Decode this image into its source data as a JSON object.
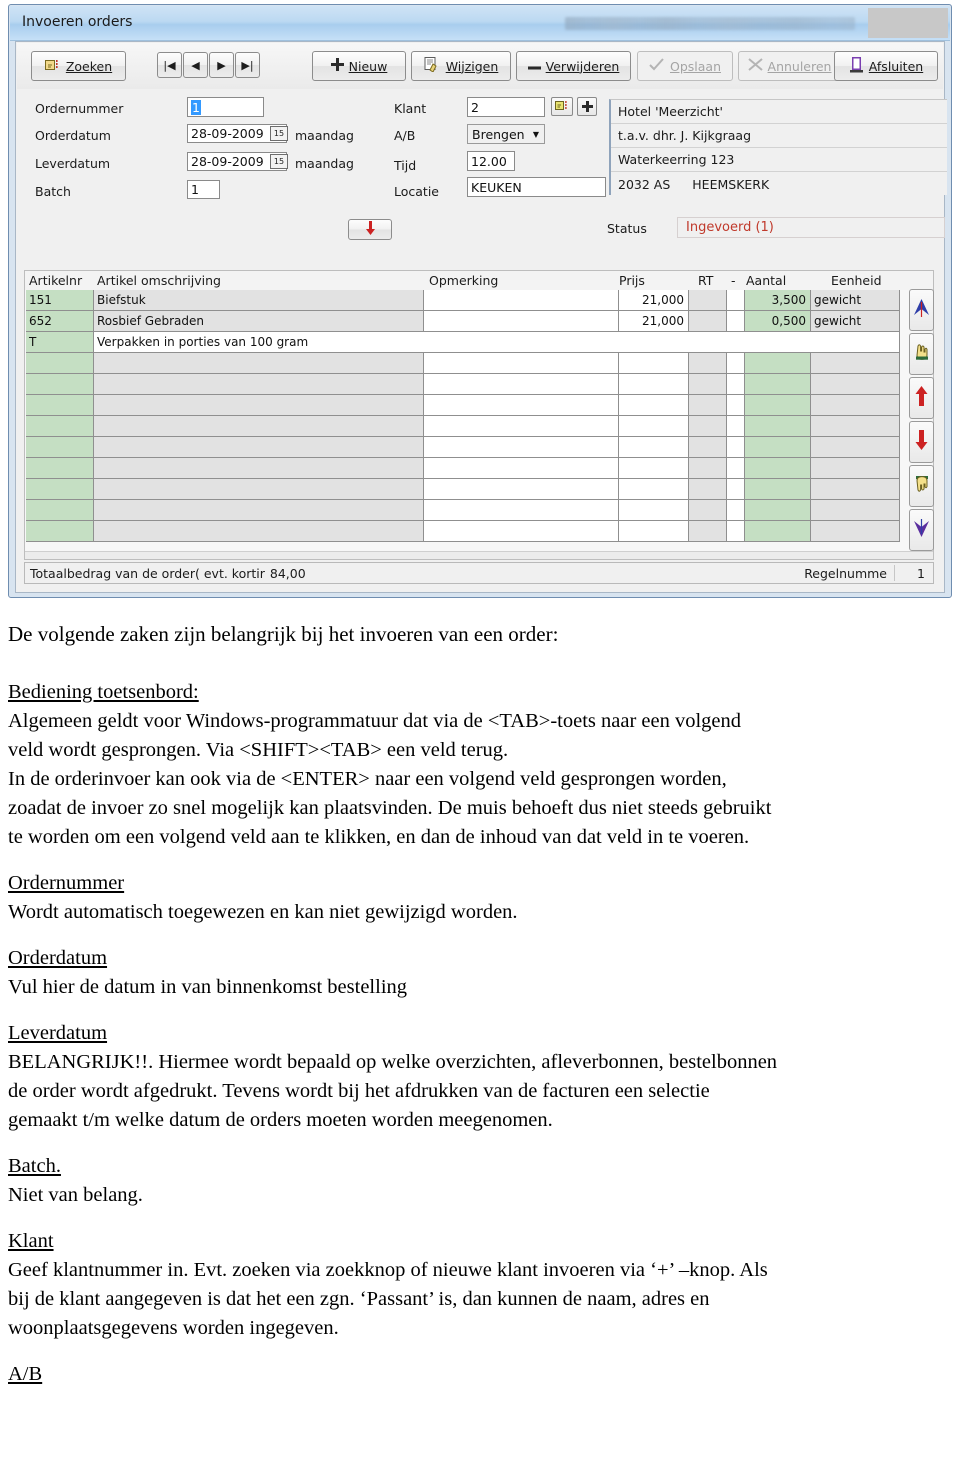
{
  "window": {
    "title": "Invoeren orders",
    "redacted_title": ""
  },
  "toolbar": {
    "zoeken": "Zoeken",
    "first": "|◀",
    "prev": "◀",
    "next": "▶",
    "last": "▶|",
    "nieuw": "Nieuw",
    "wijzigen": "Wijzigen",
    "verwijderen": "Verwijderen",
    "opslaan": "Opslaan",
    "annuleren": "Annuleren",
    "afsluiten": "Afsluiten"
  },
  "form": {
    "ordernummer_label": "Ordernummer",
    "ordernummer_value": "1",
    "orderdatum_label": "Orderdatum",
    "orderdatum_value": "28-09-2009",
    "orderdatum_day": "maandag",
    "leverdatum_label": "Leverdatum",
    "leverdatum_value": "28-09-2009",
    "leverdatum_day": "maandag",
    "batch_label": "Batch",
    "batch_value": "1",
    "klant_label": "Klant",
    "klant_value": "2",
    "ab_label": "A/B",
    "ab_value": "Brengen",
    "tijd_label": "Tijd",
    "tijd_value": "12.00",
    "locatie_label": "Locatie",
    "locatie_value": "KEUKEN",
    "calendar_glyph": "15",
    "dropdown_glyph": "▼",
    "down_arrow_glyph": "⬇"
  },
  "address": {
    "line1": "Hotel 'Meerzicht'",
    "line2": "t.a.v.  dhr. J. Kijkgraag",
    "line3": "Waterkeerring 123",
    "line4_zip": "2032 AS",
    "line4_city": "HEEMSKERK"
  },
  "status": {
    "label": "Status",
    "value": "Ingevoerd (1)",
    "color": "#c0392b"
  },
  "grid": {
    "headers": [
      "Artikelnr",
      "Artikel omschrijving",
      "Opmerking",
      "Prijs",
      "RT",
      "-",
      "Aantal",
      "Eenheid"
    ],
    "rows": [
      {
        "artikelnr": "151",
        "omschrijving": "Biefstuk",
        "opmerking": "",
        "prijs": "21,000",
        "rt": "",
        "min": "",
        "aantal": "3,500",
        "eenheid": "gewicht",
        "memo": false
      },
      {
        "artikelnr": "652",
        "omschrijving": "Rosbief Gebraden",
        "opmerking": "",
        "prijs": "21,000",
        "rt": "",
        "min": "",
        "aantal": "0,500",
        "eenheid": "gewicht",
        "memo": false
      },
      {
        "artikelnr": "T",
        "omschrijving": "Verpakken in porties van 100 gram",
        "opmerking": "",
        "prijs": "",
        "rt": "",
        "min": "",
        "aantal": "",
        "eenheid": "",
        "memo": true
      },
      {
        "artikelnr": "",
        "omschrijving": "",
        "opmerking": "",
        "prijs": "",
        "rt": "",
        "min": "",
        "aantal": "",
        "eenheid": "",
        "memo": false
      },
      {
        "artikelnr": "",
        "omschrijving": "",
        "opmerking": "",
        "prijs": "",
        "rt": "",
        "min": "",
        "aantal": "",
        "eenheid": "",
        "memo": false
      },
      {
        "artikelnr": "",
        "omschrijving": "",
        "opmerking": "",
        "prijs": "",
        "rt": "",
        "min": "",
        "aantal": "",
        "eenheid": "",
        "memo": false
      },
      {
        "artikelnr": "",
        "omschrijving": "",
        "opmerking": "",
        "prijs": "",
        "rt": "",
        "min": "",
        "aantal": "",
        "eenheid": "",
        "memo": false
      },
      {
        "artikelnr": "",
        "omschrijving": "",
        "opmerking": "",
        "prijs": "",
        "rt": "",
        "min": "",
        "aantal": "",
        "eenheid": "",
        "memo": false
      },
      {
        "artikelnr": "",
        "omschrijving": "",
        "opmerking": "",
        "prijs": "",
        "rt": "",
        "min": "",
        "aantal": "",
        "eenheid": "",
        "memo": false
      },
      {
        "artikelnr": "",
        "omschrijving": "",
        "opmerking": "",
        "prijs": "",
        "rt": "",
        "min": "",
        "aantal": "",
        "eenheid": "",
        "memo": false
      },
      {
        "artikelnr": "",
        "omschrijving": "",
        "opmerking": "",
        "prijs": "",
        "rt": "",
        "min": "",
        "aantal": "",
        "eenheid": "",
        "memo": false
      },
      {
        "artikelnr": "",
        "omschrijving": "",
        "opmerking": "",
        "prijs": "",
        "rt": "",
        "min": "",
        "aantal": "",
        "eenheid": "",
        "memo": false
      }
    ]
  },
  "vtools": {
    "top_label": "go-to-top",
    "pick_up_label": "pick-up",
    "move_up_label": "move-up",
    "move_down_label": "move-down",
    "drop_label": "drop",
    "bottom_label": "go-to-bottom"
  },
  "statusbar": {
    "total_label": "Totaalbedrag van de order( evt. kortir",
    "total_value": "84,00",
    "regelnummer_label": "Regelnumme",
    "regelnummer_value": "1"
  },
  "doc": {
    "intro": "De volgende zaken zijn belangrijk bij het invoeren van een order:",
    "s1_head": "Bediening toetsenbord:",
    "s1_l1": "Algemeen geldt voor Windows-programmatuur dat via de  <TAB>-toets naar een volgend",
    "s1_l2": "veld wordt gesprongen. Via <SHIFT><TAB> een veld terug.",
    "s1_l3": "In de orderinvoer kan ook via de <ENTER> naar een volgend veld gesprongen worden,",
    "s1_l4": "zoadat de invoer zo snel mogelijk kan plaatsvinden. De muis behoeft dus niet steeds gebruikt",
    "s1_l5": "te worden om een volgend veld aan te klikken, en dan de inhoud van dat veld in te voeren.",
    "s2_head": "Ordernummer",
    "s2_l1": "Wordt automatisch toegewezen en kan niet gewijzigd worden.",
    "s3_head": "Orderdatum",
    "s3_l1": "Vul hier de datum in van binnenkomst bestelling",
    "s4_head": "Leverdatum",
    "s4_l1": "BELANGRIJK!!. Hiermee wordt bepaald op welke overzichten, afleverbonnen, bestelbonnen",
    "s4_l2": "de order wordt afgedrukt. Tevens wordt bij het afdrukken van de facturen een selectie",
    "s4_l3": "gemaakt t/m welke datum de orders moeten worden meegenomen.",
    "s5_head": "Batch.",
    "s5_l1": "Niet van belang.",
    "s6_head": "Klant",
    "s6_l1": "Geef klantnummer in. Evt. zoeken via zoekknop of nieuwe klant invoeren via ‘+’ –knop. Als",
    "s6_l2": "bij de klant aangegeven is dat het een zgn. ‘Passant’ is, dan kunnen de naam, adres en",
    "s6_l3": "woonplaatsgegevens worden ingegeven.",
    "s7_head": "A/B"
  }
}
